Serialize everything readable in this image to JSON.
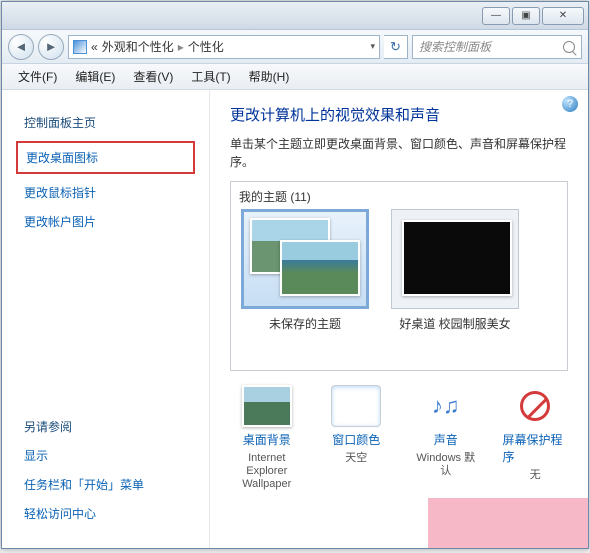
{
  "titlebar": {
    "min": "—",
    "max": "▣",
    "close": "✕"
  },
  "navbar": {
    "chevron": "«",
    "crumb1": "外观和个性化",
    "crumb2": "个性化",
    "sep": "▸",
    "refresh": "↻",
    "search_placeholder": "搜索控制面板"
  },
  "menu": {
    "file": "文件(F)",
    "edit": "编辑(E)",
    "view": "查看(V)",
    "tools": "工具(T)",
    "help": "帮助(H)"
  },
  "sidebar": {
    "home": "控制面板主页",
    "desktop_icons": "更改桌面图标",
    "mouse_pointers": "更改鼠标指针",
    "account_pic": "更改帐户图片",
    "see_also_hdr": "另请参阅",
    "display": "显示",
    "taskbar": "任务栏和「开始」菜单",
    "ease": "轻松访问中心"
  },
  "content": {
    "help": "?",
    "title": "更改计算机上的视觉效果和声音",
    "desc": "单击某个主题立即更改桌面背景、窗口颜色、声音和屏幕保护程序。",
    "my_themes": "我的主题 (11)",
    "theme_unsaved": "未保存的主题",
    "theme_2": "好桌道 校园制服美女"
  },
  "settings": {
    "wallpaper": {
      "label": "桌面背景",
      "sub": "Internet Explorer Wallpaper"
    },
    "color": {
      "label": "窗口颜色",
      "sub": "天空"
    },
    "sound": {
      "label": "声音",
      "sub": "Windows 默认",
      "icon": "♪♫"
    },
    "saver": {
      "label": "屏幕保护程序",
      "sub": "无"
    }
  }
}
